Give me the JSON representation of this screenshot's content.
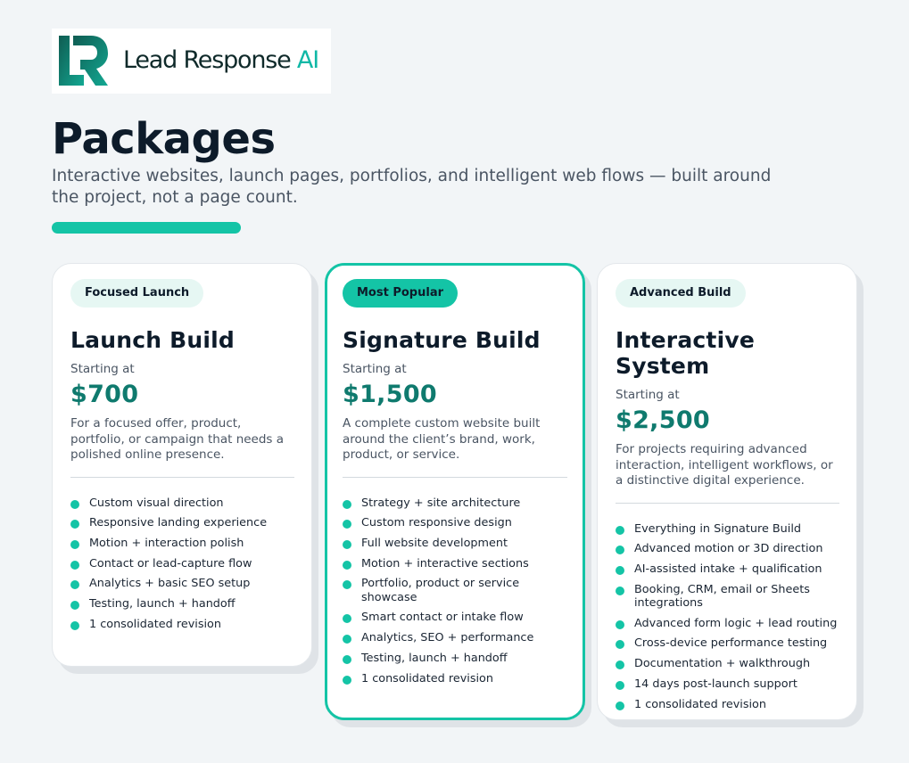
{
  "brand": {
    "name_main": "Lead Response",
    "name_ai": "AI",
    "accent": "#14c4a6",
    "price_color": "#0f7a6e"
  },
  "page": {
    "title": "Packages",
    "subtitle": "Interactive websites, launch pages, portfolios, and intelligent web flows — built around the project, not a page count."
  },
  "packages": [
    {
      "badge": "Focused Launch",
      "title": "Launch Build",
      "starting_label": "Starting at",
      "price": "$700",
      "description": "For a focused offer, product, portfolio, or campaign that needs a polished online presence.",
      "features": [
        "Custom visual direction",
        "Responsive landing experience",
        "Motion + interaction polish",
        "Contact or lead-capture flow",
        "Analytics + basic SEO setup",
        "Testing, launch + handoff",
        "1 consolidated revision"
      ]
    },
    {
      "badge": "Most Popular",
      "title": "Signature Build",
      "starting_label": "Starting at",
      "price": "$1,500",
      "description": "A complete custom website built around the client’s brand, work, product, or service.",
      "features": [
        "Strategy + site architecture",
        "Custom responsive design",
        "Full website development",
        "Motion + interactive sections",
        "Portfolio, product or service showcase",
        "Smart contact or intake flow",
        "Analytics, SEO + performance",
        "Testing, launch + handoff",
        "1 consolidated revision"
      ]
    },
    {
      "badge": "Advanced Build",
      "title": "Interactive System",
      "starting_label": "Starting at",
      "price": "$2,500",
      "description": "For projects requiring advanced interaction, intelligent workflows, or a distinctive digital experience.",
      "features": [
        "Everything in Signature Build",
        "Advanced motion or 3D direction",
        "AI-assisted intake + qualification",
        "Booking, CRM, email or Sheets integrations",
        "Advanced form logic + lead routing",
        "Cross-device performance testing",
        "Documentation + walkthrough",
        "14 days post-launch support",
        "1 consolidated revision"
      ]
    }
  ]
}
